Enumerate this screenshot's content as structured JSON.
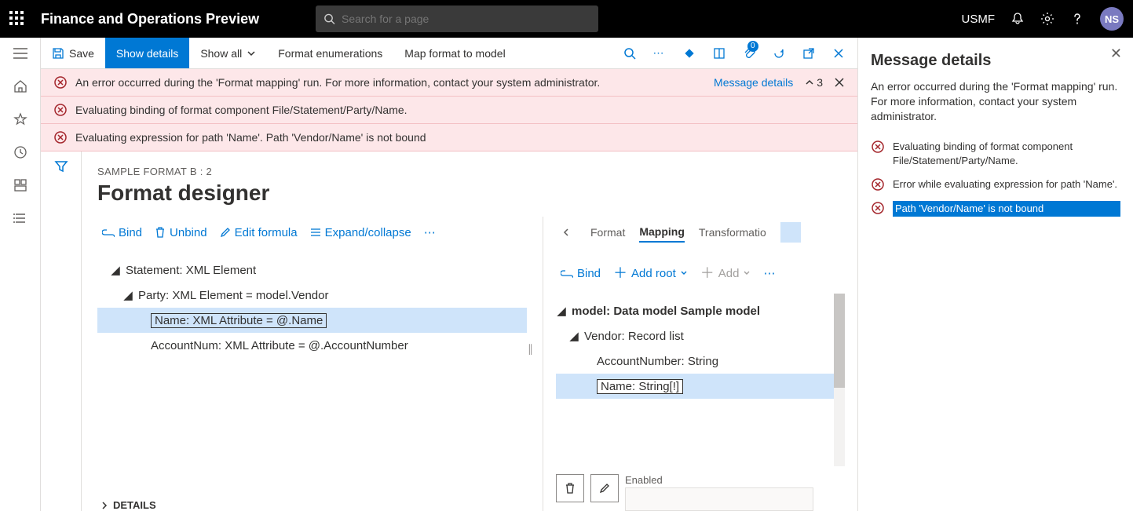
{
  "topbar": {
    "app_title": "Finance and Operations Preview",
    "search_placeholder": "Search for a page",
    "company": "USMF",
    "avatar_initials": "NS"
  },
  "action_bar": {
    "save": "Save",
    "show_details": "Show details",
    "show_all": "Show all",
    "format_enum": "Format enumerations",
    "map_format": "Map format to model",
    "pin_count": "0"
  },
  "banners": {
    "msg1": "An error occurred during the 'Format mapping' run. For more information, contact your system administrator.",
    "msg2": "Evaluating binding of format component File/Statement/Party/Name.",
    "msg3": "Evaluating expression for path 'Name'.   Path 'Vendor/Name' is not bound",
    "details_link": "Message details",
    "count": "3"
  },
  "designer": {
    "breadcrumb": "SAMPLE FORMAT B : 2",
    "title": "Format designer",
    "left_toolbar": {
      "bind": "Bind",
      "unbind": "Unbind",
      "edit_formula": "Edit formula",
      "expand": "Expand/collapse"
    },
    "left_tree": {
      "n1": "Statement: XML Element",
      "n2": "Party: XML Element = model.Vendor",
      "n3": "Name: XML Attribute = @.Name",
      "n4": "AccountNum: XML Attribute = @.AccountNumber"
    },
    "details_label": "DETAILS",
    "right_tabs": {
      "format": "Format",
      "mapping": "Mapping",
      "transform": "Transformatio"
    },
    "right_toolbar": {
      "bind": "Bind",
      "add_root": "Add root",
      "add": "Add"
    },
    "right_tree": {
      "n1": "model: Data model Sample model",
      "n2": "Vendor: Record list",
      "n3": "AccountNumber: String",
      "n4": "Name: String[!]"
    },
    "right_field_label": "Enabled"
  },
  "msg_panel": {
    "title": "Message details",
    "desc": "An error occurred during the 'Format mapping' run. For more information, contact your system administrator.",
    "items": [
      "Evaluating binding of format component File/Statement/Party/Name.",
      "Error while evaluating expression for path 'Name'.",
      "Path 'Vendor/Name' is not bound"
    ]
  }
}
